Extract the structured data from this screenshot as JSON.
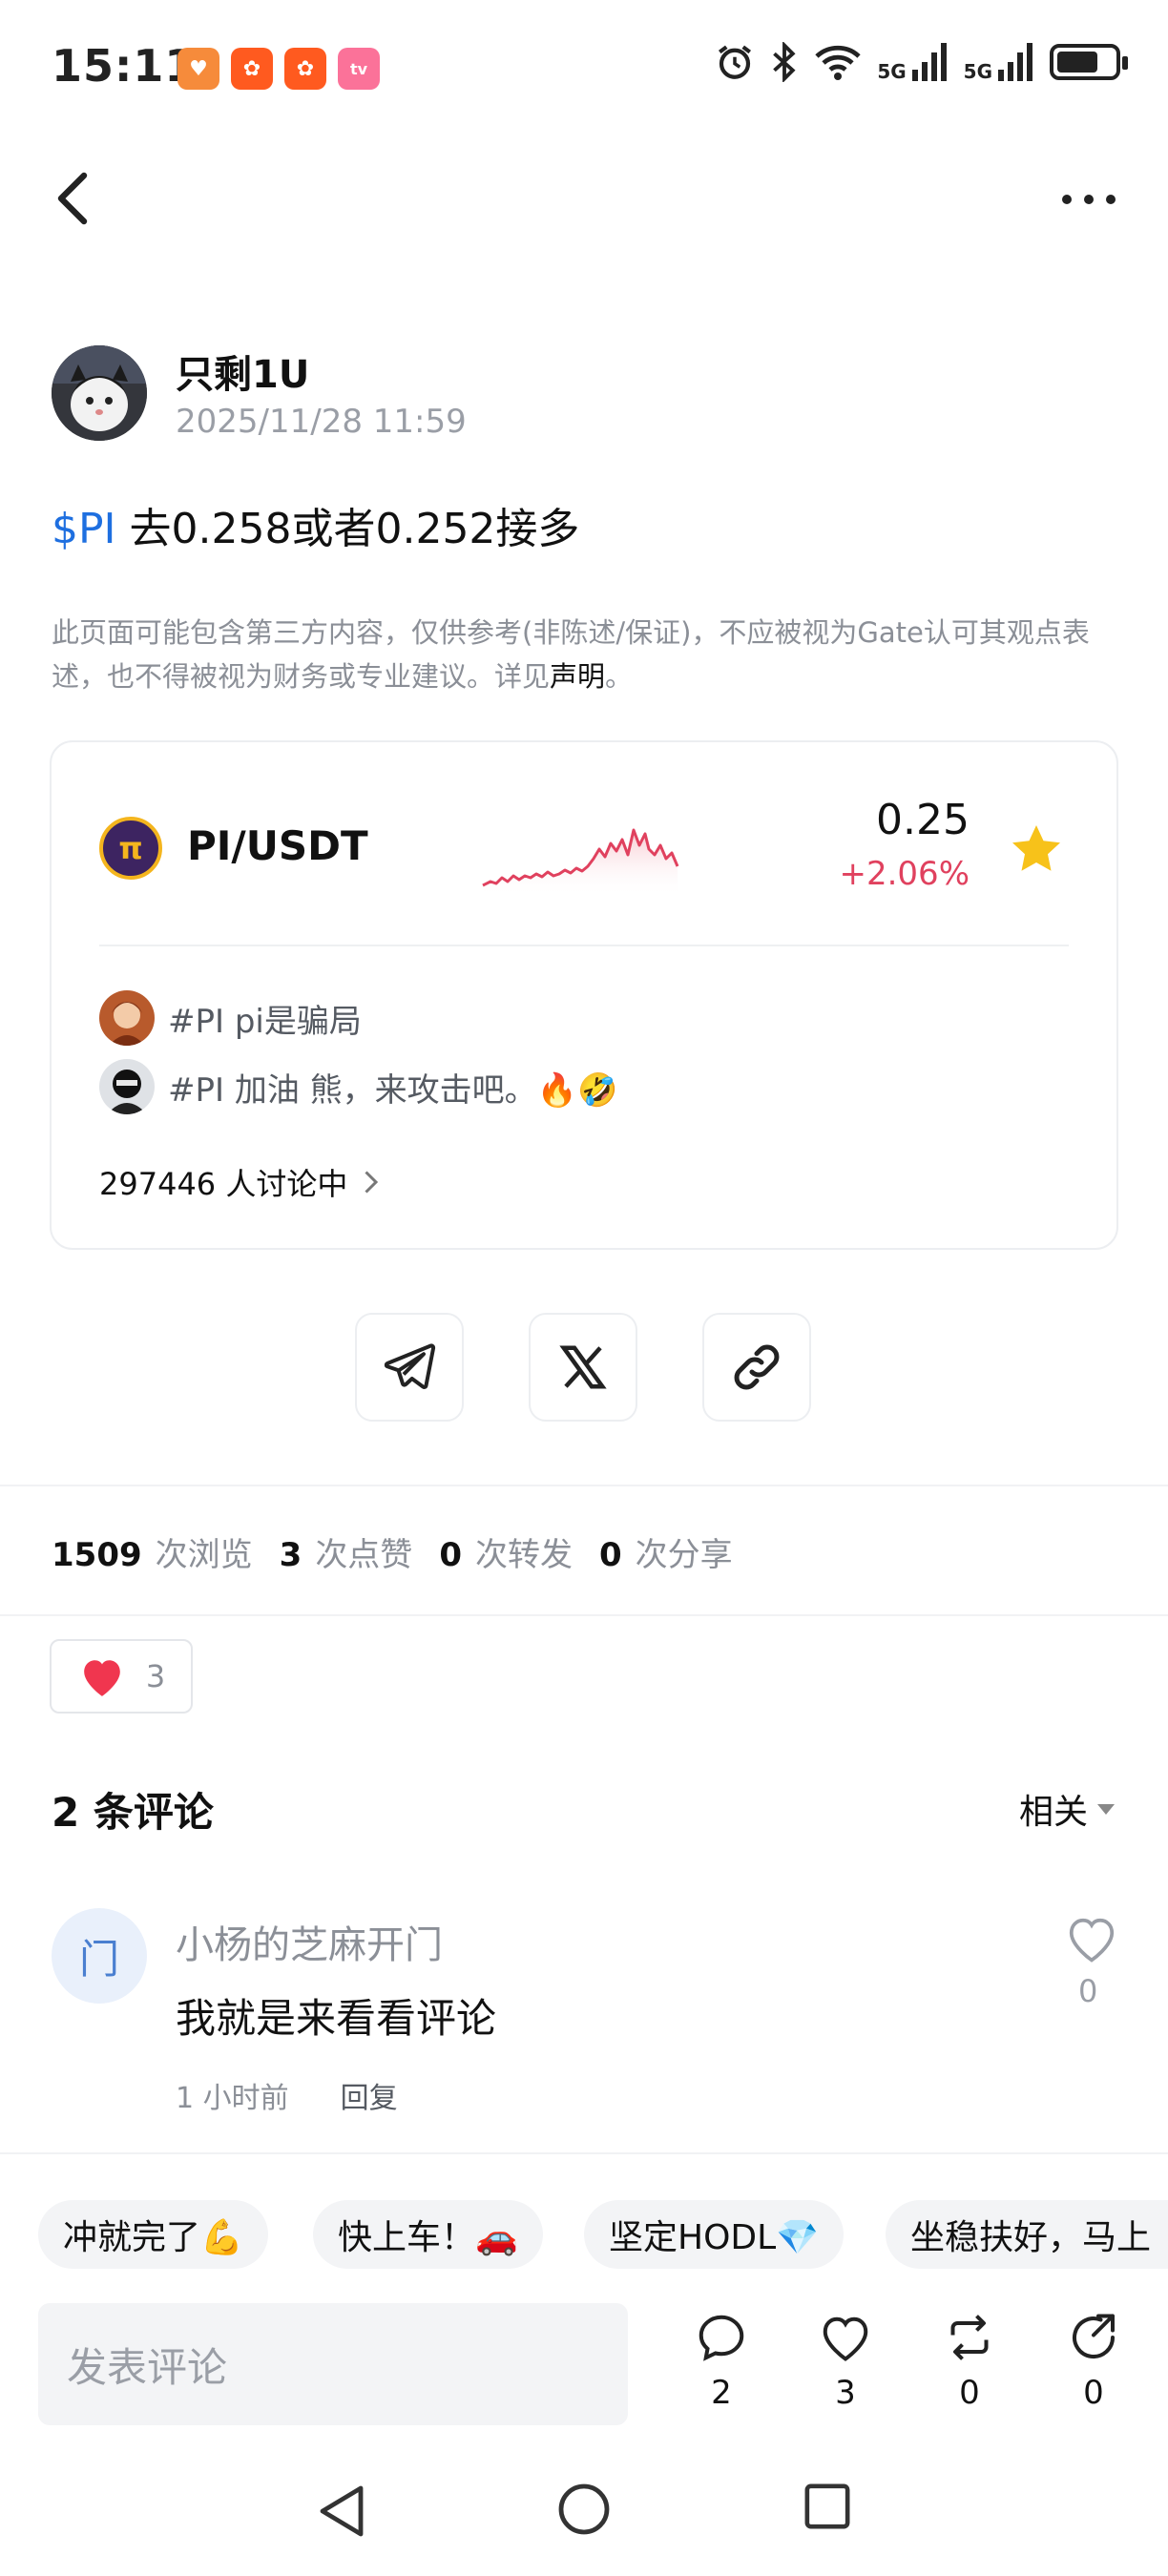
{
  "status_bar": {
    "time": "15:11",
    "network1": "5G",
    "network2": "5G",
    "apps": [
      "app-icon-orange-heart",
      "app-icon-kuaishou-1",
      "app-icon-kuaishou-2",
      "app-icon-bilibili"
    ]
  },
  "post": {
    "author": "只剩1U",
    "date": "2025/11/28 11:59",
    "tag": "$PI",
    "text": " 去0.258或者0.252接多",
    "disclaimer": "此页面可能包含第三方内容，仅供参考(非陈述/保证)，不应被视为Gate认可其观点表述，也不得被视为财务或专业建议。详见",
    "disclaimer_link": "声明",
    "disclaimer_end": "。"
  },
  "market": {
    "pair": "PI/USDT",
    "price": "0.25",
    "change": "+2.06%",
    "change_color": "#e0415e",
    "topics": [
      {
        "text": "#PI pi是骗局"
      },
      {
        "text": "#PI  加油 熊，来攻击吧。🔥🤣"
      }
    ],
    "discussion": "297446 人讨论中"
  },
  "share": [
    "telegram-icon",
    "x-icon",
    "link-icon"
  ],
  "stats": {
    "views": "1509",
    "views_label": "次浏览",
    "likes": "3",
    "likes_label": "次点赞",
    "reposts": "0",
    "reposts_label": "次转发",
    "shares": "0",
    "shares_label": "次分享"
  },
  "reaction": {
    "count": "3"
  },
  "comments": {
    "title": "2 条评论",
    "sort": "相关",
    "items": [
      {
        "avatar_char": "门",
        "name": "小杨的芝麻开门",
        "text": "我就是来看看评论",
        "time": "1 小时前",
        "reply": "回复",
        "likes": "0"
      }
    ]
  },
  "quick_replies": [
    "冲就完了💪",
    "快上车！🚗",
    "坚定HODL💎",
    "坐稳扶好，马上"
  ],
  "bottom_bar": {
    "placeholder": "发表评论",
    "comments": "2",
    "likes": "3",
    "reposts": "0",
    "shares": "0"
  },
  "colors": {
    "accent_blue": "#1e6fe0",
    "star": "#f7c21a",
    "heart": "#f0364f"
  }
}
